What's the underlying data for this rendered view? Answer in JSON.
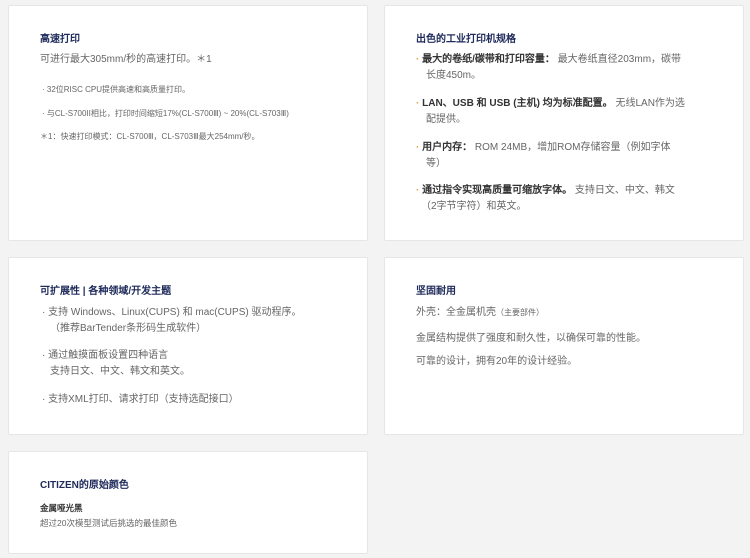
{
  "cards": {
    "high_speed": {
      "title": "高速打印",
      "lead": "可进行最大305mm/秒的高速打印。＊1",
      "items": [
        "· 32位RISC CPU提供高速和高质量打印。",
        "· 与CL-S700II相比，打印时间缩短17%(CL-S700Ⅲ) ~ 20%(CL-S703Ⅲ)"
      ],
      "note": "＊1：快速打印模式：CL-S700Ⅲ，CL-S703Ⅲ最大254mm/秒。"
    },
    "specs": {
      "title": "出色的工业打印机规格",
      "items": [
        {
          "bullet": "·",
          "strong": "最大的卷纸/碳带和打印容量：",
          "text_line1": "最大卷纸直径203mm，碳带",
          "text_line2": "长度450m。"
        },
        {
          "bullet": "·",
          "strong": "LAN、USB 和 USB (主机) 均为标准配置。",
          "text_line1": "无线LAN作为选",
          "text_line2": "配提供。"
        },
        {
          "bullet": "·",
          "strong": "用户内存：",
          "text_line1": "ROM 24MB，增加ROM存储容量（例如字体",
          "text_line2": "等）"
        },
        {
          "bullet": "·",
          "strong": "通过指令实现高质量可缩放字体。",
          "text_line1": "支持日文、中文、韩文",
          "text_line2": "（2字节字符）和英文。"
        }
      ]
    },
    "extensible": {
      "title": "可扩展性 | 各种领域/开发主题",
      "items": [
        {
          "line1": "· 支持 Windows、Linux(CUPS) 和 mac(CUPS) 驱动程序。",
          "line2": "（推荐BarTender条形码生成软件）"
        },
        {
          "line1": "· 通过触摸面板设置四种语言",
          "line2": "支持日文、中文、韩文和英文。"
        },
        {
          "line1": "· 支持XML打印、请求打印（支持选配接口）",
          "line2": ""
        }
      ]
    },
    "durable": {
      "title": "坚固耐用",
      "line1_main": "外壳：全金属机壳",
      "line1_sub": "（主要部件）",
      "line2": "金属结构提供了强度和耐久性，以确保可靠的性能。",
      "line3": "可靠的设计，拥有20年的设计经验。"
    },
    "color": {
      "title": "CITIZEN的原始颜色",
      "subtitle": "金属哑光黑",
      "desc": "超过20次模型测试后挑选的最佳颜色"
    }
  },
  "colors": {
    "title": "#1e2a5a",
    "accent_bullet": "#e0a14a",
    "card_bg": "#ffffff",
    "page_bg": "#f3f3f3"
  }
}
